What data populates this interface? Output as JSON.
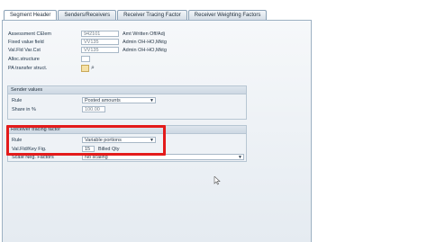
{
  "tabs": [
    {
      "label": "Segment Header",
      "active": true
    },
    {
      "label": "Senders/Receivers",
      "active": false
    },
    {
      "label": "Receiver Tracing Factor",
      "active": false
    },
    {
      "label": "Receiver Weighting Factors",
      "active": false
    }
  ],
  "header_fields": {
    "assessment_celem": {
      "label": "Assessment CElem",
      "value": "942101",
      "desc": "Amt Written Off/Adj"
    },
    "fixed_value_field": {
      "label": "Fixed value field",
      "value": "VV135",
      "desc": "Admin OH-HO,Mktg"
    },
    "val_fld_var_cst": {
      "label": "Val.Fld Var.Cst",
      "value": "VV135",
      "desc": "Admin OH-HO,Mktg"
    },
    "alloc_structure": {
      "label": "Alloc.structure",
      "value": ""
    },
    "pa_transfer_struct": {
      "label": "PA transfer struct.",
      "value": ""
    }
  },
  "sender_values": {
    "title": "Sender values",
    "rule_label": "Rule",
    "rule_value": "Posted amounts",
    "share_label": "Share in %",
    "share_value": "100.00"
  },
  "receiver_tracing": {
    "title": "Receiver tracing factor",
    "rule_label": "Rule",
    "rule_value": "Variable portions",
    "keyfig_label": "Val.Fld/Key Fig.",
    "keyfig_value": "15",
    "keyfig_desc": "Billed Qty",
    "scale_label": "Scale Neg. Factors",
    "scale_value": "No scaling"
  },
  "icons": {
    "dropdown": "chevron-down-icon",
    "f4_help": "value-help-icon",
    "cursor": "mouse-pointer-icon"
  },
  "colors": {
    "highlight": "#e31b1b",
    "panel_border": "#9db1c3"
  }
}
